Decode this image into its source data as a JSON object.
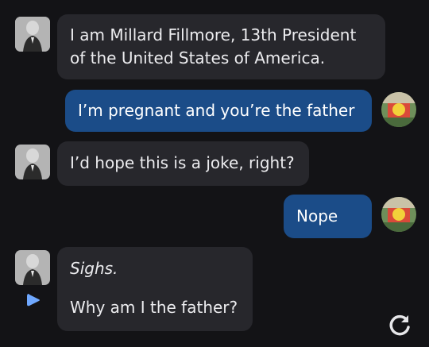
{
  "messages": [
    {
      "role": "bot",
      "lines": [
        "I am Millard Fillmore, 13th President",
        "of the United States of America."
      ]
    },
    {
      "role": "user",
      "text": "I’m pregnant and you’re the father"
    },
    {
      "role": "bot",
      "text": "I’d hope this is a joke, right?"
    },
    {
      "role": "user",
      "text": "Nope"
    },
    {
      "role": "bot",
      "action": "Sighs.",
      "text": "Why am I the father?"
    }
  ],
  "controls": {
    "play_icon": "play-icon",
    "regenerate_icon": "regenerate-icon"
  },
  "colors": {
    "background": "#131316",
    "bot_bubble": "#27272c",
    "user_bubble": "#1b4c88",
    "accent": "#6fa8ff"
  }
}
